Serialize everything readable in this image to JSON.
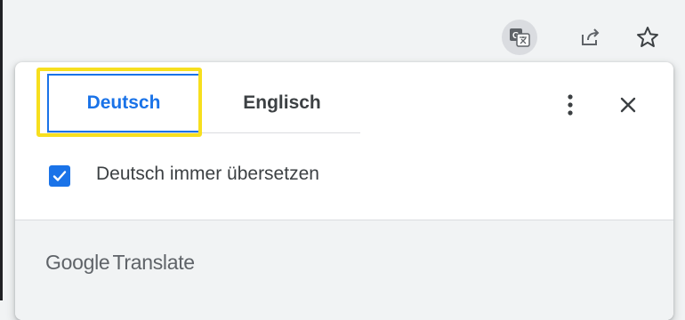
{
  "toolbar": {
    "translate_icon": "translate-icon",
    "share_icon": "share-icon",
    "bookmark_icon": "star-icon"
  },
  "popup": {
    "tabs": [
      {
        "label": "Deutsch",
        "selected": true
      },
      {
        "label": "Englisch",
        "selected": false
      }
    ],
    "menu_icon": "more-vert-icon",
    "close_icon": "close-icon",
    "checkbox": {
      "label": "Deutsch immer übersetzen",
      "checked": true
    },
    "footer": {
      "brand_google": "Google",
      "brand_translate": "Translate"
    }
  },
  "colors": {
    "accent": "#1a73e8",
    "highlight": "#f7df1e",
    "text": "#3c4043",
    "muted": "#5f6368"
  }
}
